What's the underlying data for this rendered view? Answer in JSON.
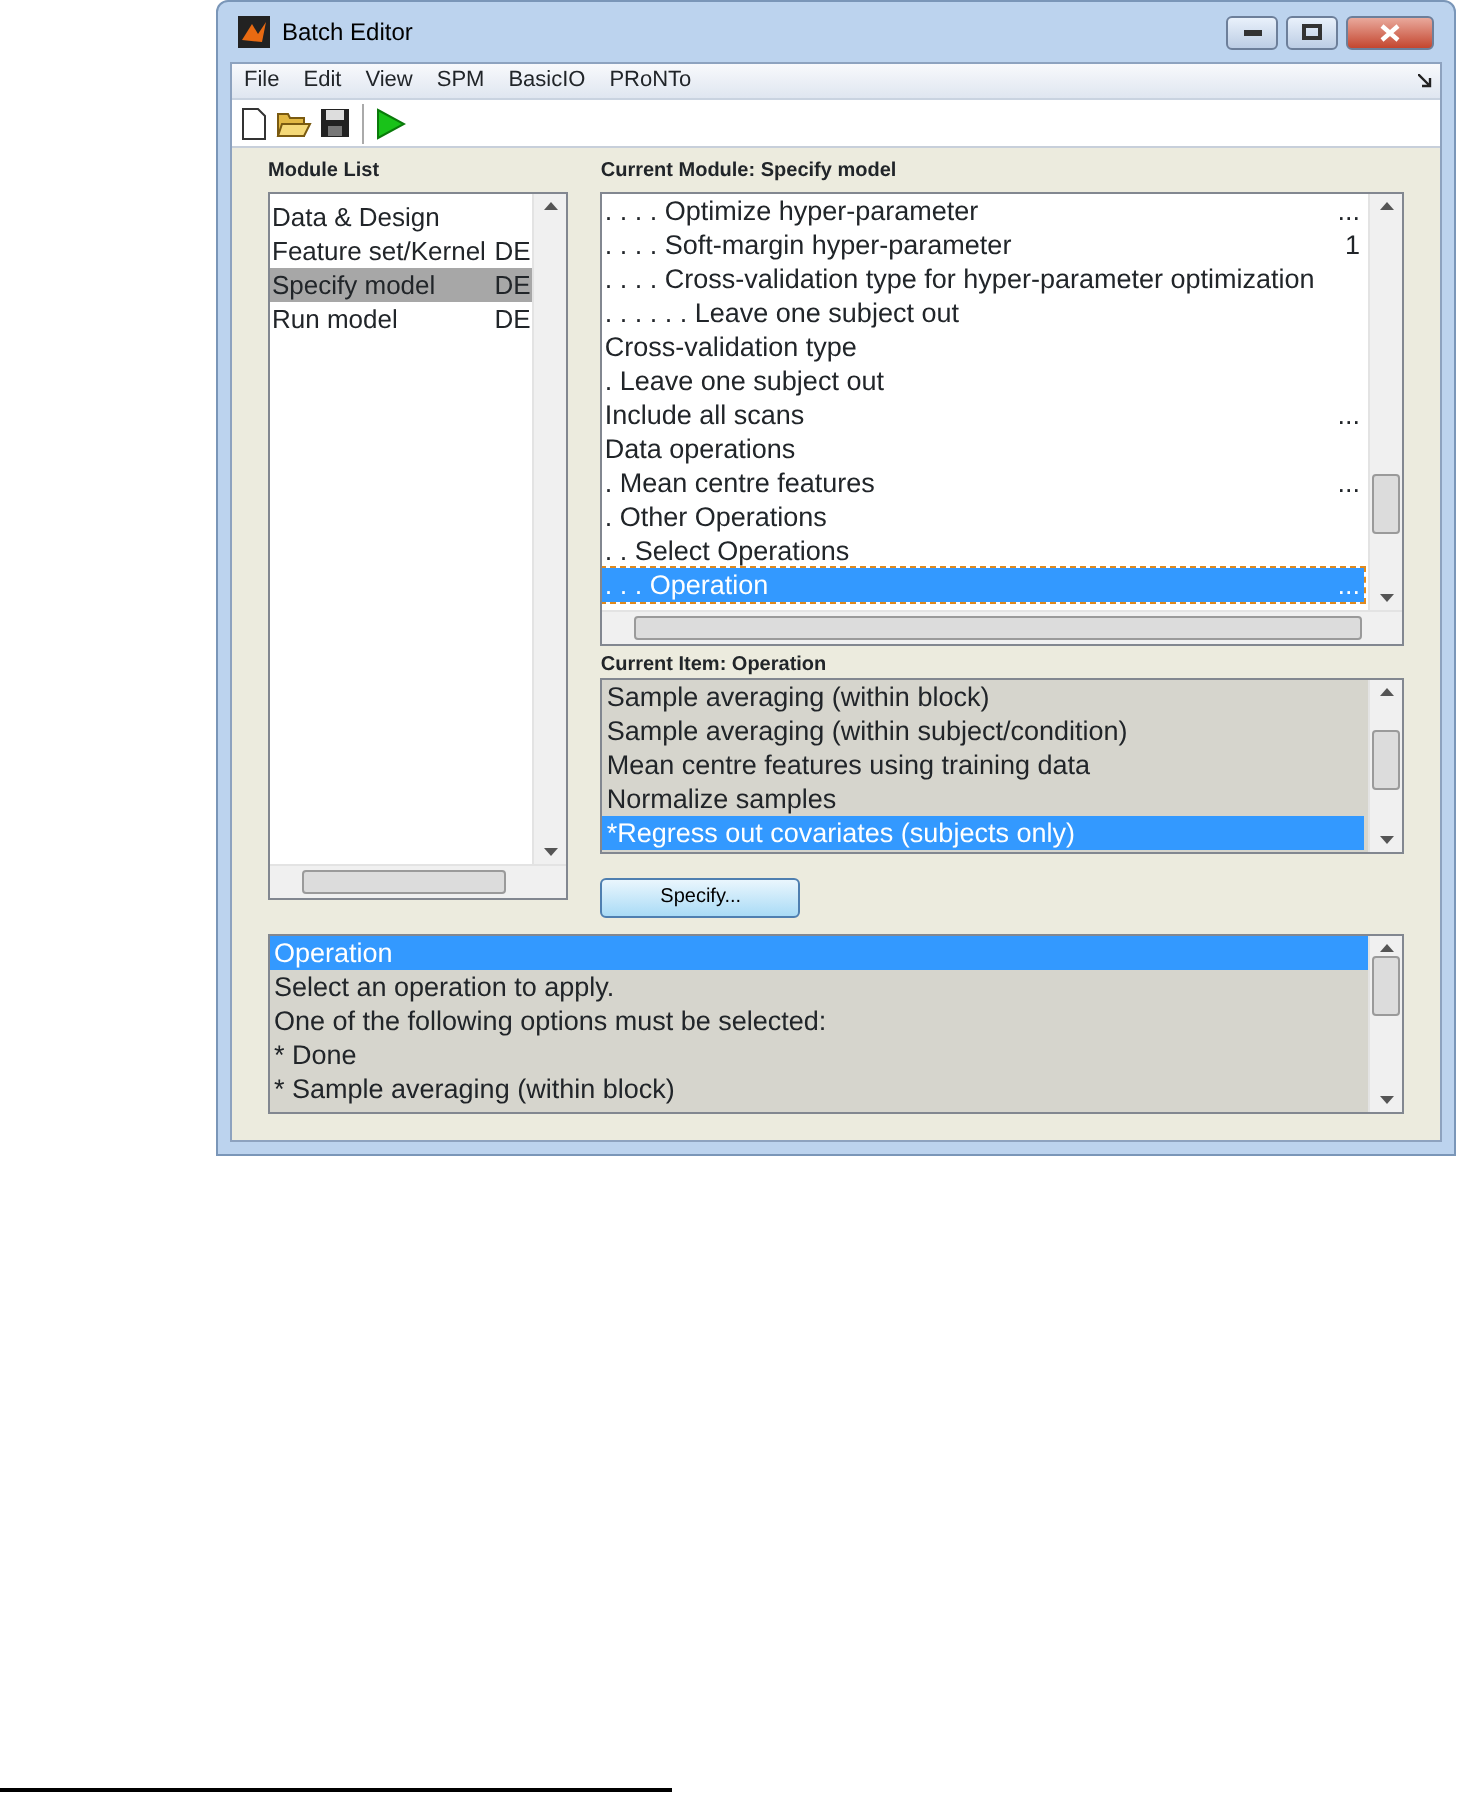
{
  "window": {
    "title": "Batch Editor"
  },
  "menu": [
    "File",
    "Edit",
    "View",
    "SPM",
    "BasicIO",
    "PRoNTo"
  ],
  "module_list": {
    "label": "Module List",
    "items": [
      {
        "name": "Data & Design",
        "selected": false
      },
      {
        "name": "Feature set/Kernel",
        "status": "DE",
        "selected": false
      },
      {
        "name": "Specify model",
        "status": "DE",
        "selected": true
      },
      {
        "name": "Run model",
        "status": "DE",
        "selected": false
      }
    ]
  },
  "current_module": {
    "label": "Current Module: Specify model",
    "rows": [
      {
        "text": ". . . . Optimize hyper-parameter",
        "value": "...",
        "selected": false
      },
      {
        "text": ". . . . Soft-margin hyper-parameter",
        "value": "1",
        "selected": false
      },
      {
        "text": ". . . . Cross-validation type for hyper-parameter optimization",
        "selected": false
      },
      {
        "text": ". . . . . . Leave one subject out",
        "selected": false
      },
      {
        "text": "Cross-validation type",
        "selected": false
      },
      {
        "text": ". Leave one subject out",
        "selected": false
      },
      {
        "text": "Include all scans",
        "value": "...",
        "selected": false
      },
      {
        "text": "Data operations",
        "selected": false
      },
      {
        "text": ". Mean centre features",
        "value": "...",
        "selected": false
      },
      {
        "text": ". Other Operations",
        "selected": false
      },
      {
        "text": ". . Select Operations",
        "selected": false
      },
      {
        "text": ". . . Operation",
        "value": "...",
        "selected": true
      }
    ]
  },
  "current_item": {
    "label": "Current Item: Operation",
    "options": [
      {
        "text": "Sample averaging (within block)",
        "selected": false
      },
      {
        "text": "Sample averaging (within subject/condition)",
        "selected": false
      },
      {
        "text": "Mean centre features using training data",
        "selected": false
      },
      {
        "text": "Normalize samples",
        "selected": false
      },
      {
        "text": "*Regress out covariates (subjects only)",
        "selected": true
      }
    ]
  },
  "specify_button": "Specify...",
  "help": {
    "lines": [
      {
        "text": "Operation",
        "selected": true
      },
      {
        "text": "Select an operation to apply.",
        "selected": false
      },
      {
        "text": "One of the following options must be selected:",
        "selected": false
      },
      {
        "text": "* Done",
        "selected": false
      },
      {
        "text": "* Sample averaging (within block)",
        "selected": false
      }
    ]
  }
}
